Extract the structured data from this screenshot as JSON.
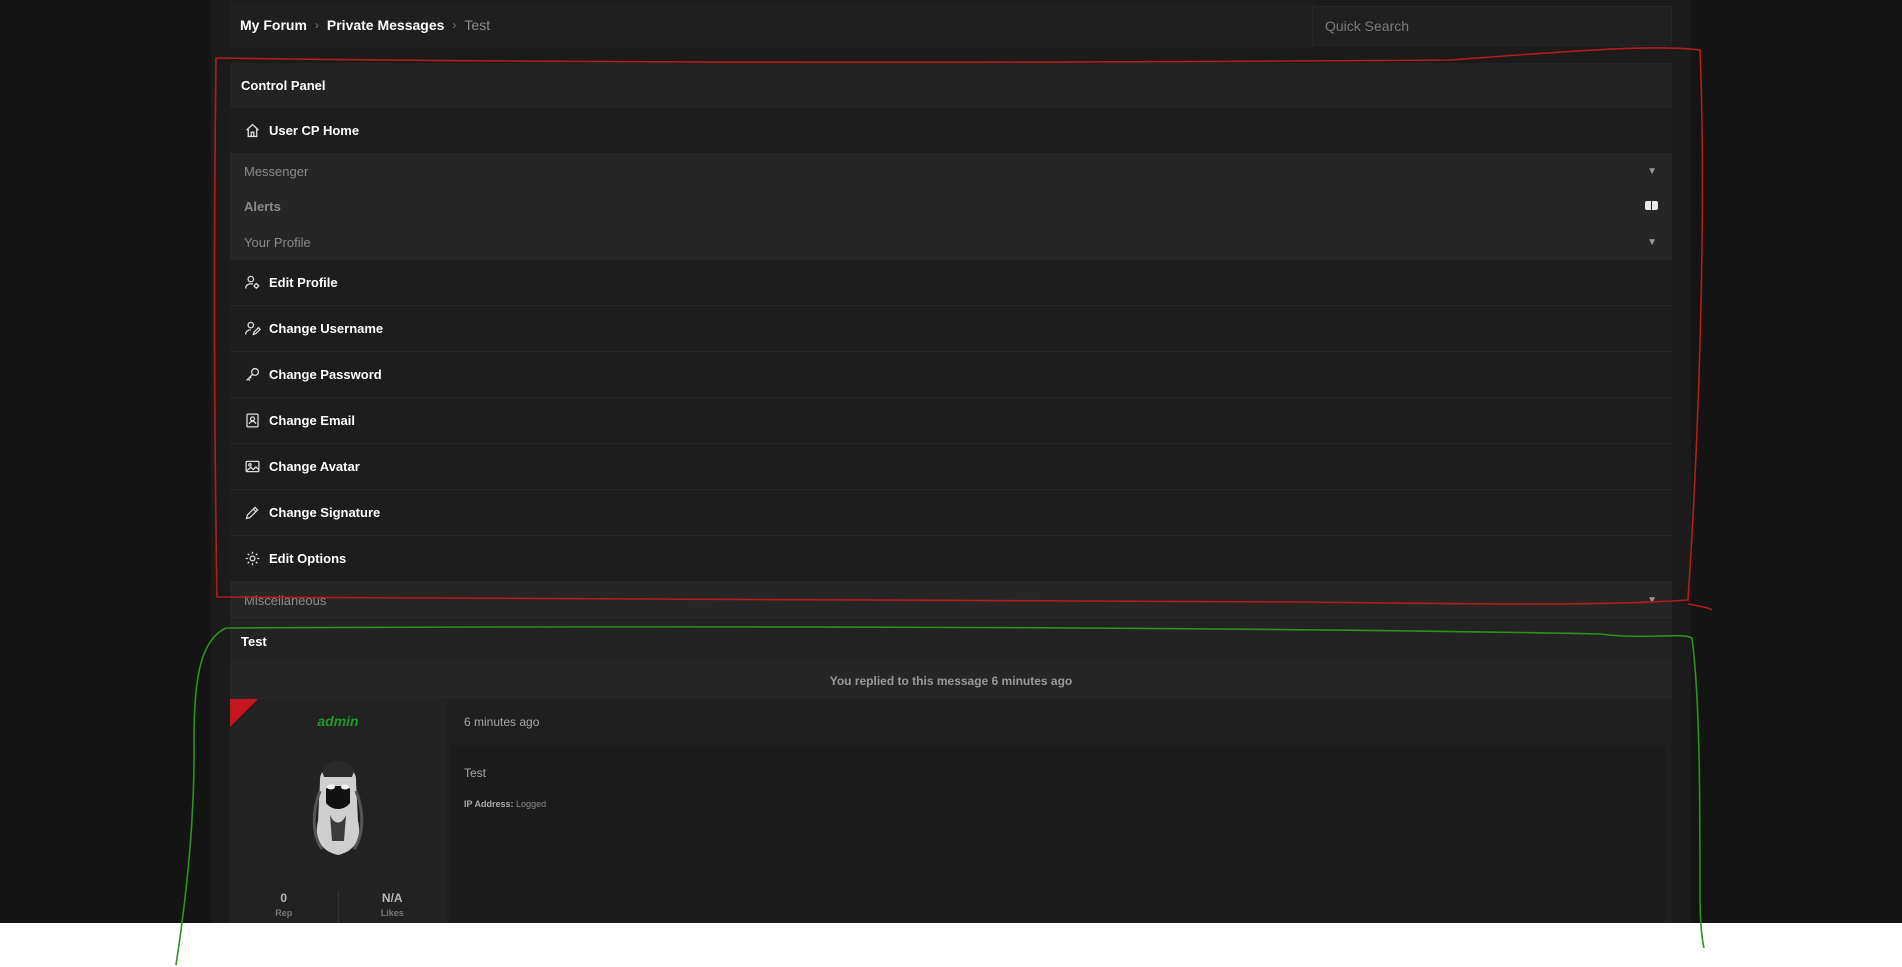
{
  "breadcrumb": {
    "items": [
      "My Forum",
      "Private Messages"
    ],
    "current": "Test",
    "separator": "›"
  },
  "search": {
    "placeholder": "Quick Search"
  },
  "control_panel": {
    "title": "Control Panel",
    "home": {
      "label": "User CP Home",
      "icon": "home-icon"
    },
    "messenger": {
      "label": "Messenger"
    },
    "alerts": {
      "label": "Alerts"
    },
    "your_profile": {
      "label": "Your Profile"
    },
    "profile_items": [
      {
        "label": "Edit Profile",
        "icon": "user-gear-icon"
      },
      {
        "label": "Change Username",
        "icon": "user-edit-icon"
      },
      {
        "label": "Change Password",
        "icon": "key-icon"
      },
      {
        "label": "Change Email",
        "icon": "contact-card-icon"
      },
      {
        "label": "Change Avatar",
        "icon": "image-icon"
      },
      {
        "label": "Change Signature",
        "icon": "pencil-icon"
      },
      {
        "label": "Edit Options",
        "icon": "gear-icon"
      }
    ],
    "miscellaneous": {
      "label": "Miscellaneous"
    }
  },
  "message": {
    "title": "Test",
    "replied_notice": "You replied to this message 6 minutes ago",
    "author": "admin",
    "time": "6 minutes ago",
    "body": "Test",
    "ip_label": "IP Address:",
    "ip_value": "Logged",
    "stats": [
      {
        "value": "0",
        "label": "Rep"
      },
      {
        "value": "N/A",
        "label": "Likes"
      }
    ]
  },
  "colors": {
    "annotation_red": "#b11c1c",
    "annotation_green": "#2f8f1f",
    "username": "#1f9a2a",
    "corner": "#c4161c"
  }
}
